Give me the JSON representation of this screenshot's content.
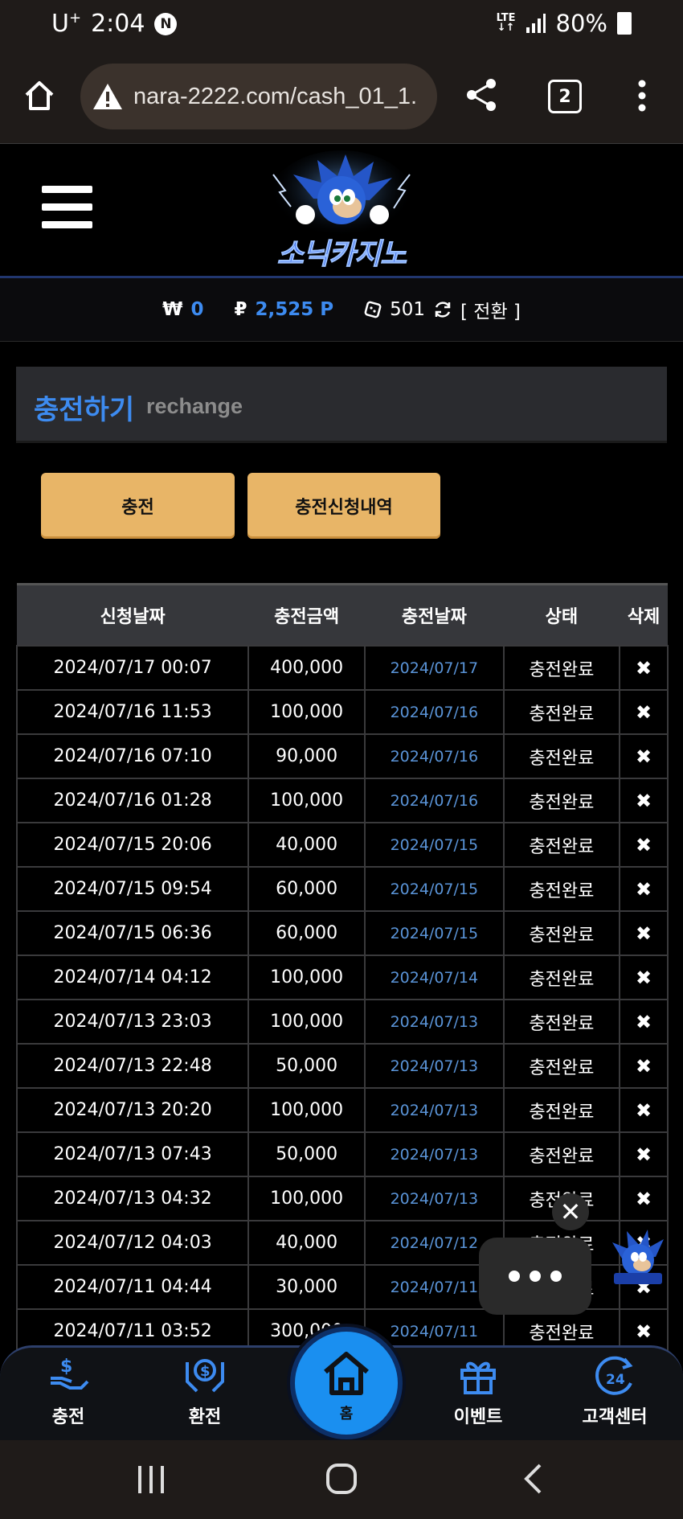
{
  "status_bar": {
    "time": "2:04",
    "carrier": "U",
    "carrier_sup": "+",
    "n_badge": "N",
    "network": "LTE",
    "battery": "80%"
  },
  "browser": {
    "url": "nara-2222.com/cash_01_1.",
    "tab_count": "2"
  },
  "header": {
    "logo_text": "소닉카지노"
  },
  "balance": {
    "won_symbol": "₩",
    "won_value": "0",
    "point_symbol": "₽",
    "point_value": "2,525 P",
    "chip_value": "501",
    "convert_label": "[ 전환 ]"
  },
  "section": {
    "title_ko": "충전하기",
    "title_en": "rechange"
  },
  "buttons": {
    "charge": "충전",
    "history": "충전신청내역"
  },
  "table": {
    "headers": [
      "신청날짜",
      "충전금액",
      "충전날짜",
      "상태",
      "삭제"
    ],
    "delete_symbol": "✖",
    "rows": [
      {
        "req": "2024/07/17 00:07",
        "amount": "400,000",
        "date": "2024/07/17",
        "status": "충전완료"
      },
      {
        "req": "2024/07/16 11:53",
        "amount": "100,000",
        "date": "2024/07/16",
        "status": "충전완료"
      },
      {
        "req": "2024/07/16 07:10",
        "amount": "90,000",
        "date": "2024/07/16",
        "status": "충전완료"
      },
      {
        "req": "2024/07/16 01:28",
        "amount": "100,000",
        "date": "2024/07/16",
        "status": "충전완료"
      },
      {
        "req": "2024/07/15 20:06",
        "amount": "40,000",
        "date": "2024/07/15",
        "status": "충전완료"
      },
      {
        "req": "2024/07/15 09:54",
        "amount": "60,000",
        "date": "2024/07/15",
        "status": "충전완료"
      },
      {
        "req": "2024/07/15 06:36",
        "amount": "60,000",
        "date": "2024/07/15",
        "status": "충전완료"
      },
      {
        "req": "2024/07/14 04:12",
        "amount": "100,000",
        "date": "2024/07/14",
        "status": "충전완료"
      },
      {
        "req": "2024/07/13 23:03",
        "amount": "100,000",
        "date": "2024/07/13",
        "status": "충전완료"
      },
      {
        "req": "2024/07/13 22:48",
        "amount": "50,000",
        "date": "2024/07/13",
        "status": "충전완료"
      },
      {
        "req": "2024/07/13 20:20",
        "amount": "100,000",
        "date": "2024/07/13",
        "status": "충전완료"
      },
      {
        "req": "2024/07/13 07:43",
        "amount": "50,000",
        "date": "2024/07/13",
        "status": "충전완료"
      },
      {
        "req": "2024/07/13 04:32",
        "amount": "100,000",
        "date": "2024/07/13",
        "status": "충전완료"
      },
      {
        "req": "2024/07/12 04:03",
        "amount": "40,000",
        "date": "2024/07/12",
        "status": "충전완료"
      },
      {
        "req": "2024/07/11 04:44",
        "amount": "30,000",
        "date": "2024/07/11",
        "status": "충전완료"
      },
      {
        "req": "2024/07/11 03:52",
        "amount": "300,000",
        "date": "2024/07/11",
        "status": "충전완료"
      }
    ]
  },
  "floating": {
    "close_symbol": "✕"
  },
  "bottom_nav": {
    "charge": "충전",
    "exchange": "환전",
    "home": "홈",
    "event": "이벤트",
    "support": "고객센터"
  },
  "colors": {
    "accent_blue": "#3d8bf0",
    "button_gold": "#e8b567",
    "home_blue": "#1a8ff0"
  }
}
